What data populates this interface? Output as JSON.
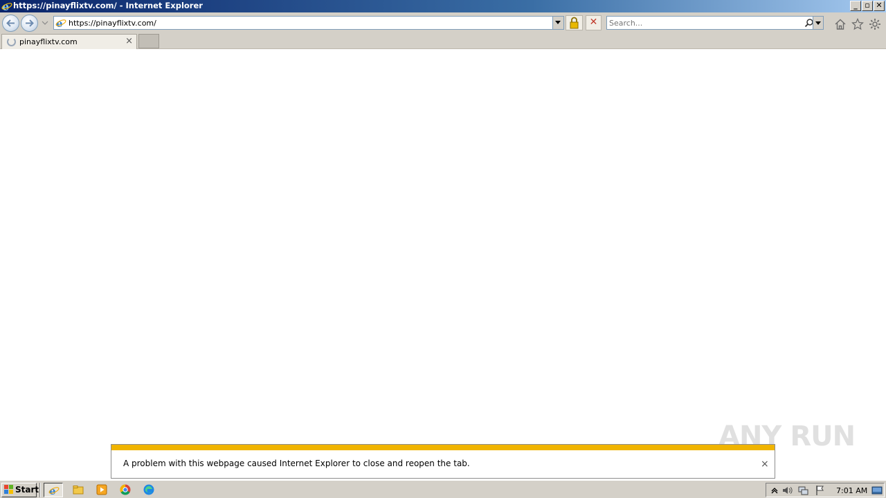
{
  "window": {
    "title": "https://pinayflixtv.com/ - Internet Explorer",
    "minimize": "_",
    "restore": "▫",
    "close": "✕"
  },
  "nav": {
    "address": "https://pinayflixtv.com/",
    "search_placeholder": "Search..."
  },
  "tabs": [
    {
      "label": "pinayflixtv.com",
      "close": "×"
    }
  ],
  "notification": {
    "message": "A problem with this webpage caused Internet Explorer to close and reopen the tab.",
    "close": "×"
  },
  "watermark": "ANY RUN",
  "taskbar": {
    "start_label": "Start",
    "apps": [
      "internet-explorer",
      "file-explorer",
      "media-player",
      "chrome",
      "edge"
    ],
    "clock": "7:01 AM"
  },
  "colors": {
    "titlebar": "#0a246a",
    "chrome_bg": "#d4d0c8",
    "notification_stripe": "#f0b400"
  }
}
